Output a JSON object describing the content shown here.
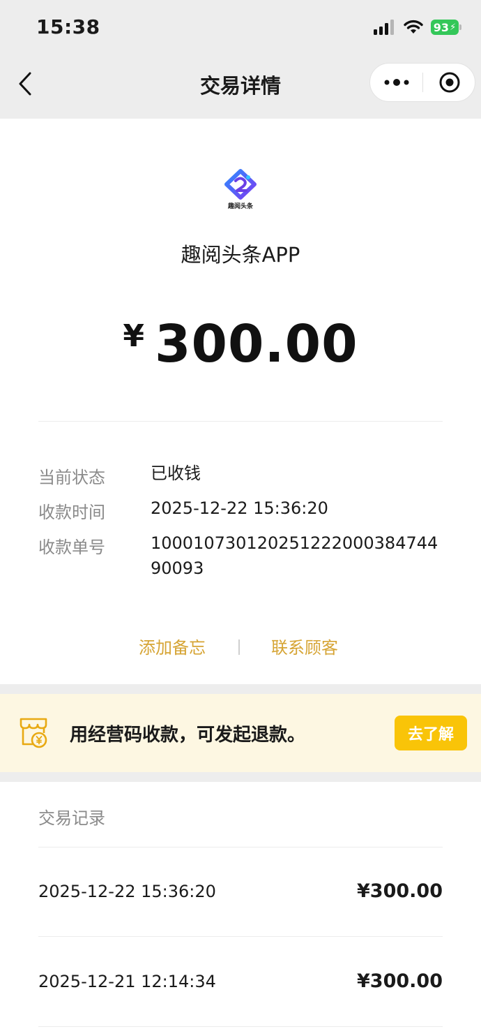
{
  "status_bar": {
    "time": "15:38",
    "battery": "93"
  },
  "nav": {
    "title": "交易详情"
  },
  "merchant": {
    "logo_text": "趣阅头条",
    "name": "趣阅头条APP"
  },
  "amount": {
    "currency": "¥",
    "value": "300.00"
  },
  "details": [
    {
      "label": "当前状态",
      "value": "已收钱"
    },
    {
      "label": "收款时间",
      "value": "2025-12-22 15:36:20"
    },
    {
      "label": "收款单号",
      "value": "10001073012025122200038474490093"
    }
  ],
  "actions": {
    "add_note": "添加备忘",
    "contact_customer": "联系顾客"
  },
  "promo": {
    "text": "用经营码收款，可发起退款。",
    "button": "去了解"
  },
  "records": {
    "title": "交易记录",
    "items": [
      {
        "time": "2025-12-22 15:36:20",
        "amount": "¥300.00"
      },
      {
        "time": "2025-12-21 12:14:34",
        "amount": "¥300.00"
      }
    ]
  },
  "colors": {
    "accent_gold": "#d6a434",
    "promo_button": "#f9c408",
    "promo_bg": "#fdf7e2",
    "battery_green": "#34c759"
  }
}
